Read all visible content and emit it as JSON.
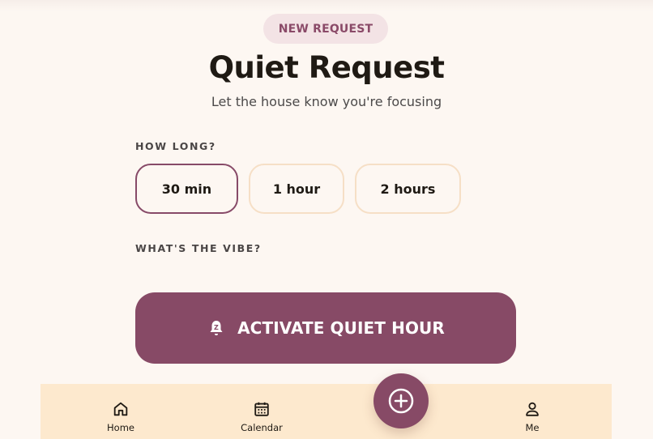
{
  "header": {
    "badge": "NEW REQUEST",
    "title": "Quiet Request",
    "subtitle": "Let the house know you're focusing"
  },
  "duration": {
    "label": "HOW LONG?",
    "options": [
      {
        "label": "30 min",
        "selected": true
      },
      {
        "label": "1 hour",
        "selected": false
      },
      {
        "label": "2 hours",
        "selected": false
      }
    ]
  },
  "vibe": {
    "label": "WHAT'S THE VIBE?"
  },
  "action": {
    "label": "ACTIVATE QUIET HOUR",
    "icon": "bell-snooze-icon"
  },
  "nav": {
    "items": [
      {
        "label": "Home",
        "icon": "home-icon"
      },
      {
        "label": "Calendar",
        "icon": "calendar-icon"
      },
      {
        "label": "Me",
        "icon": "person-icon"
      }
    ],
    "fab_icon": "plus-circle-icon"
  },
  "colors": {
    "accent": "#874a66",
    "background": "#fdf7f2",
    "nav_background": "#fde9ce",
    "chip_border": "#f6dfc6",
    "badge_background": "#f3e3e5"
  }
}
